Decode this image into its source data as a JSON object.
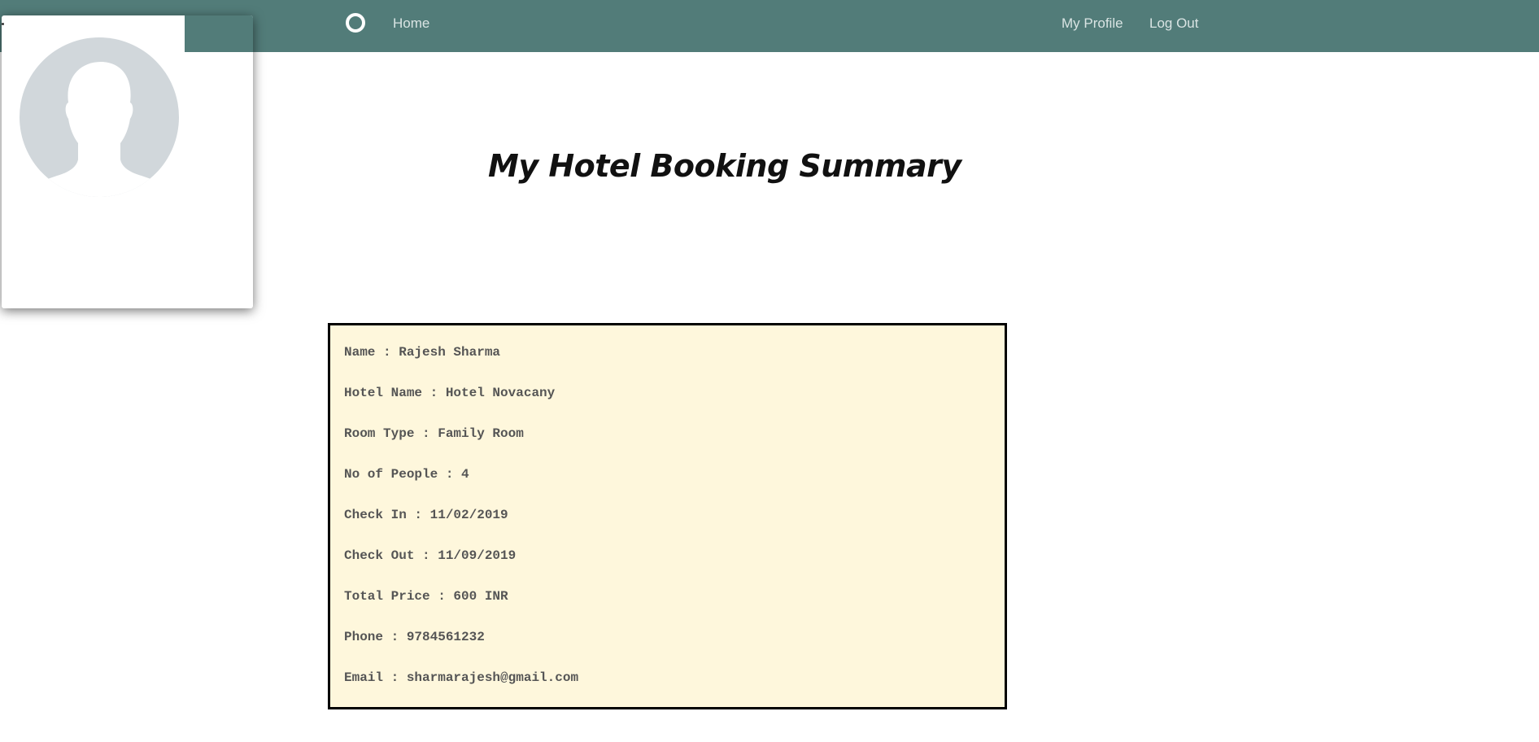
{
  "navbar": {
    "background_color": "#527c79",
    "logo_icon": "circle-logo-icon",
    "home_label": "Home",
    "my_profile_label": "My Profile",
    "log_out_label": "Log Out"
  },
  "profile_card": {
    "avatar_icon": "default-user-avatar-icon"
  },
  "page": {
    "title": "My Hotel Booking Summary"
  },
  "summary": {
    "background_color": "#fef7dc",
    "lines": [
      "Name : Rajesh Sharma",
      "Hotel Name : Hotel Novacany",
      "Room Type : Family Room",
      "No of People : 4",
      "Check In : 11/02/2019",
      "Check Out : 11/09/2019",
      "Total Price : 600 INR",
      "Phone : 9784561232",
      "Email : sharmarajesh@gmail.com"
    ]
  }
}
